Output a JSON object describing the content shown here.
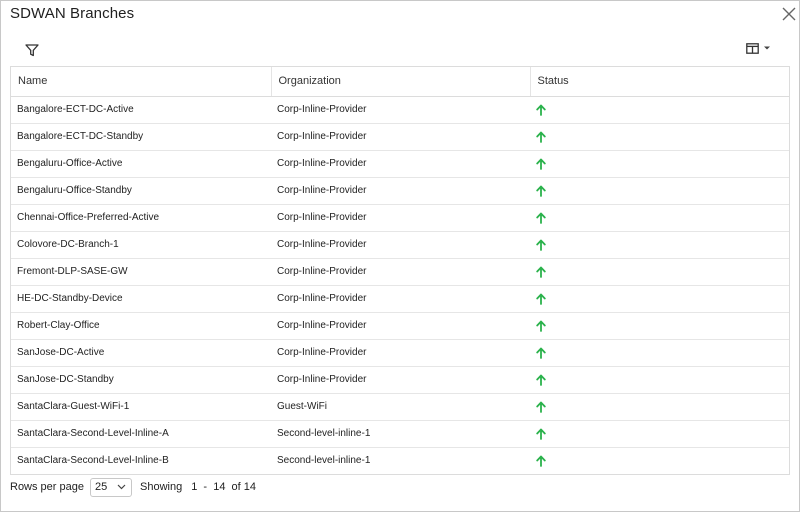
{
  "dialog": {
    "title": "SDWAN Branches"
  },
  "icons": {
    "close": "close-icon",
    "filter": "filter-icon",
    "columns": "columns-icon",
    "status_up": "arrow-up-icon"
  },
  "colors": {
    "status_up": "#2bb24c"
  },
  "table": {
    "headers": {
      "name": "Name",
      "organization": "Organization",
      "status": "Status"
    },
    "rows": [
      {
        "name": "Bangalore-ECT-DC-Active",
        "organization": "Corp-Inline-Provider",
        "status": "up"
      },
      {
        "name": "Bangalore-ECT-DC-Standby",
        "organization": "Corp-Inline-Provider",
        "status": "up"
      },
      {
        "name": "Bengaluru-Office-Active",
        "organization": "Corp-Inline-Provider",
        "status": "up"
      },
      {
        "name": "Bengaluru-Office-Standby",
        "organization": "Corp-Inline-Provider",
        "status": "up"
      },
      {
        "name": "Chennai-Office-Preferred-Active",
        "organization": "Corp-Inline-Provider",
        "status": "up"
      },
      {
        "name": "Colovore-DC-Branch-1",
        "organization": "Corp-Inline-Provider",
        "status": "up"
      },
      {
        "name": "Fremont-DLP-SASE-GW",
        "organization": "Corp-Inline-Provider",
        "status": "up"
      },
      {
        "name": "HE-DC-Standby-Device",
        "organization": "Corp-Inline-Provider",
        "status": "up"
      },
      {
        "name": "Robert-Clay-Office",
        "organization": "Corp-Inline-Provider",
        "status": "up"
      },
      {
        "name": "SanJose-DC-Active",
        "organization": "Corp-Inline-Provider",
        "status": "up"
      },
      {
        "name": "SanJose-DC-Standby",
        "organization": "Corp-Inline-Provider",
        "status": "up"
      },
      {
        "name": "SantaClara-Guest-WiFi-1",
        "organization": "Guest-WiFi",
        "status": "up"
      },
      {
        "name": "SantaClara-Second-Level-Inline-A",
        "organization": "Second-level-inline-1",
        "status": "up"
      },
      {
        "name": "SantaClara-Second-Level-Inline-B",
        "organization": "Second-level-inline-1",
        "status": "up"
      }
    ]
  },
  "pagination": {
    "rows_per_page_label": "Rows per page",
    "rows_per_page_value": "25",
    "showing_label": "Showing",
    "range_text": "1  -  14  of 14"
  }
}
